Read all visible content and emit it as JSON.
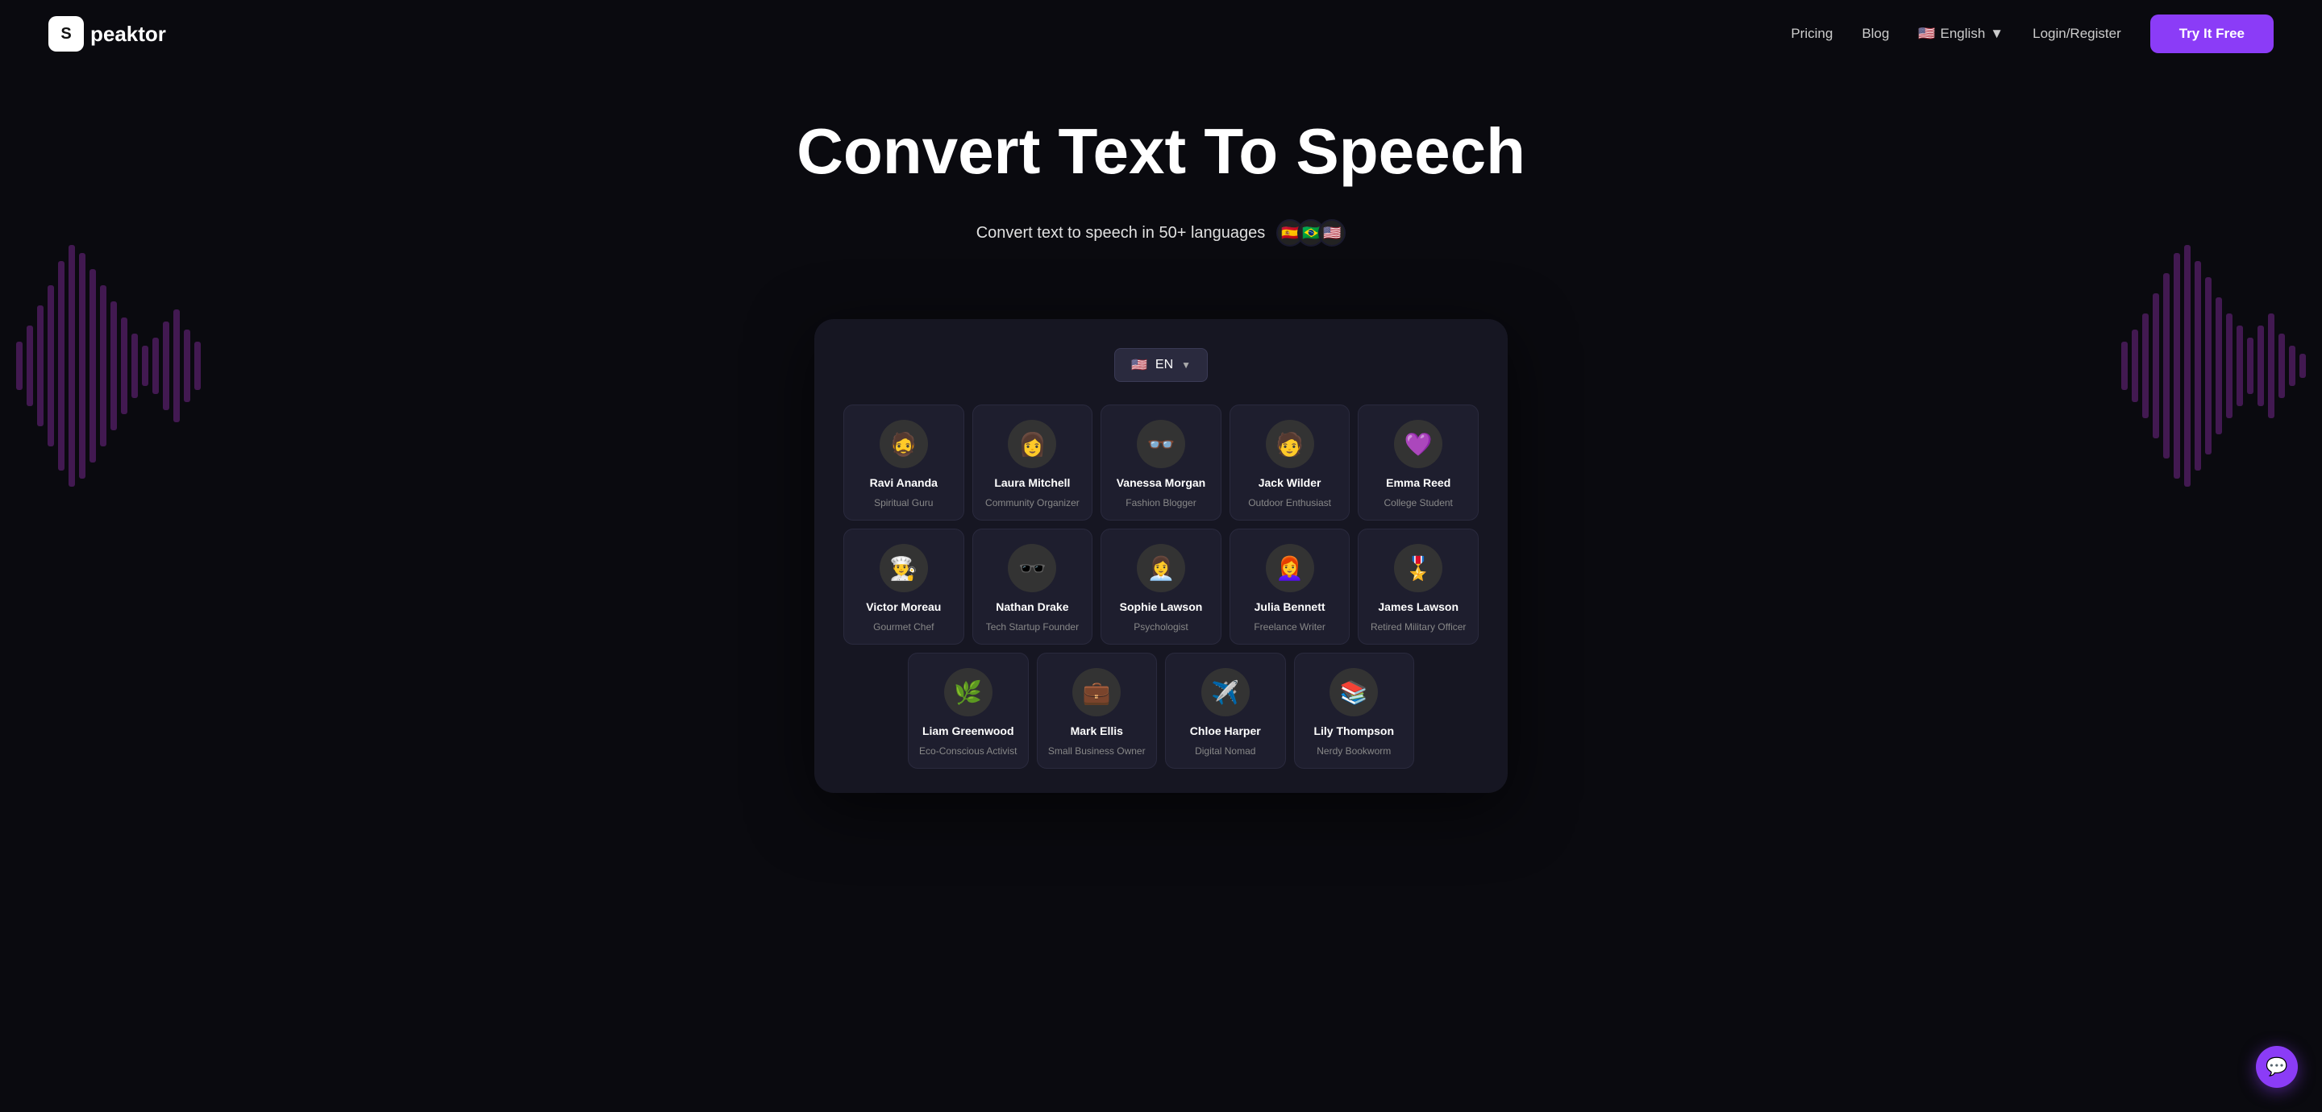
{
  "nav": {
    "logo_box": "S",
    "logo_text": "peaktor",
    "links": [
      {
        "label": "Pricing",
        "id": "pricing"
      },
      {
        "label": "Blog",
        "id": "blog"
      }
    ],
    "lang": {
      "flag": "🇺🇸",
      "label": "English",
      "arrow": "▼"
    },
    "login_label": "Login/Register",
    "try_label": "Try It Free"
  },
  "hero": {
    "title": "Convert Text To Speech",
    "subtitle": "Convert text to speech in 50+ languages",
    "flags": [
      "🇪🇸",
      "🇧🇷",
      "🇺🇸"
    ]
  },
  "panel": {
    "lang_dropdown": {
      "flag": "🇺🇸",
      "label": "EN",
      "arrow": "▼"
    },
    "voices_row1": [
      {
        "name": "Ravi Ananda",
        "role": "Spiritual Guru",
        "emoji": "🧔",
        "av": "av-1"
      },
      {
        "name": "Laura Mitchell",
        "role": "Community Organizer",
        "emoji": "👩",
        "av": "av-2"
      },
      {
        "name": "Vanessa Morgan",
        "role": "Fashion Blogger",
        "emoji": "👓",
        "av": "av-3"
      },
      {
        "name": "Jack Wilder",
        "role": "Outdoor Enthusiast",
        "emoji": "🧑",
        "av": "av-4"
      },
      {
        "name": "Emma Reed",
        "role": "College Student",
        "emoji": "💜",
        "av": "av-5"
      }
    ],
    "voices_row2": [
      {
        "name": "Victor Moreau",
        "role": "Gourmet Chef",
        "emoji": "👨‍🍳",
        "av": "av-6"
      },
      {
        "name": "Nathan Drake",
        "role": "Tech Startup Founder",
        "emoji": "🕶️",
        "av": "av-7"
      },
      {
        "name": "Sophie Lawson",
        "role": "Psychologist",
        "emoji": "👩‍💼",
        "av": "av-8"
      },
      {
        "name": "Julia Bennett",
        "role": "Freelance Writer",
        "emoji": "👩‍🦰",
        "av": "av-9"
      },
      {
        "name": "James Lawson",
        "role": "Retired Military Officer",
        "emoji": "🎖️",
        "av": "av-10"
      }
    ],
    "voices_row3": [
      {
        "name": "Liam Greenwood",
        "role": "Eco-Conscious Activist",
        "emoji": "🌿",
        "av": "av-11"
      },
      {
        "name": "Mark Ellis",
        "role": "Small Business Owner",
        "emoji": "💼",
        "av": "av-12"
      },
      {
        "name": "Chloe Harper",
        "role": "Digital Nomad",
        "emoji": "✈️",
        "av": "av-13"
      },
      {
        "name": "Lily Thompson",
        "role": "Nerdy Bookworm",
        "emoji": "📚",
        "av": "av-14"
      }
    ]
  },
  "chat_icon": "💬"
}
